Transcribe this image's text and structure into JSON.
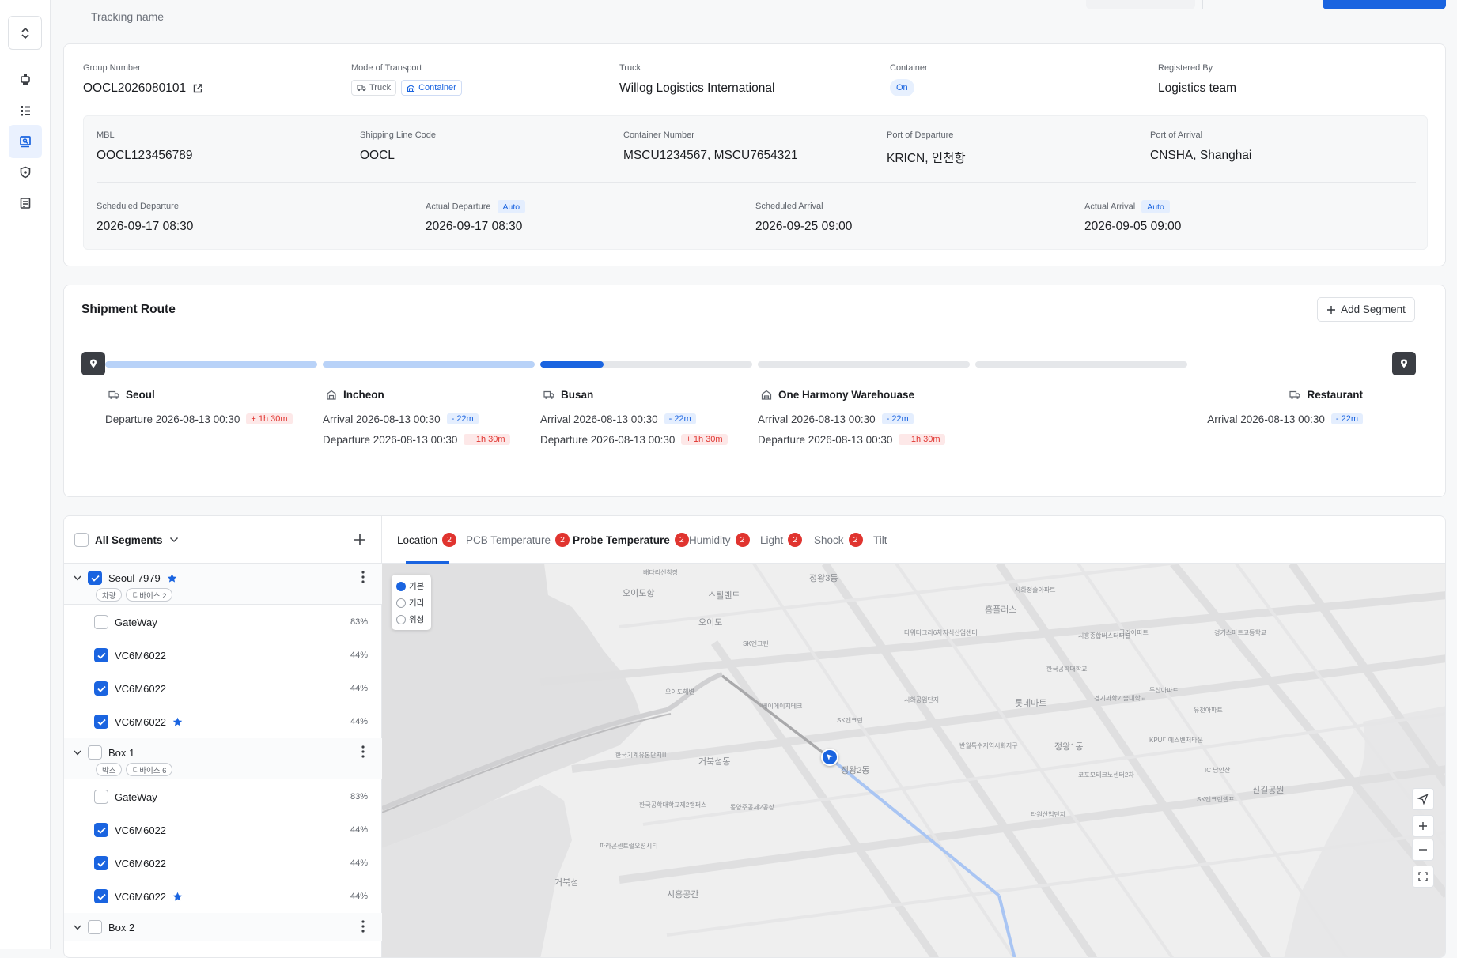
{
  "header": {
    "tracking_label": "Tracking name"
  },
  "info": {
    "group_number": {
      "label": "Group Number",
      "value": "OOCL2026080101"
    },
    "mode": {
      "label": "Mode of Transport",
      "tags": [
        "Truck",
        "Container"
      ]
    },
    "truck": {
      "label": "Truck",
      "value": "Willog Logistics International"
    },
    "container": {
      "label": "Container",
      "value": "On"
    },
    "registered": {
      "label": "Registered By",
      "value": "Logistics team"
    },
    "mbl": {
      "label": "MBL",
      "value": "OOCL123456789"
    },
    "shipping_line": {
      "label": "Shipping Line Code",
      "value": "OOCL"
    },
    "container_number": {
      "label": "Container Number",
      "value": "MSCU1234567, MSCU7654321"
    },
    "pod": {
      "label": "Port of Departure",
      "value": "KRICN, 인천항"
    },
    "poa": {
      "label": "Port of Arrival",
      "value": "CNSHA, Shanghai"
    },
    "sched_dep": {
      "label": "Scheduled Departure",
      "value": "2026-09-17 08:30"
    },
    "actual_dep": {
      "label": "Actual Departure",
      "auto": "Auto",
      "value": "2026-09-17 08:30"
    },
    "sched_arr": {
      "label": "Scheduled Arrival",
      "value": "2026-09-25 09:00"
    },
    "actual_arr": {
      "label": "Actual Arrival",
      "auto": "Auto",
      "value": "2026-09-05 09:00"
    }
  },
  "route": {
    "title": "Shipment Route",
    "add_segment": "Add Segment",
    "progress": [
      1,
      1,
      0.3,
      0,
      0
    ],
    "stops": [
      {
        "name": "Seoul",
        "icon": "truck-icon",
        "lines": [
          {
            "text": "Departure 2026-08-13 00:30",
            "delta": "+ 1h 30m",
            "type": "late"
          }
        ]
      },
      {
        "name": "Incheon",
        "icon": "container-icon",
        "lines": [
          {
            "text": "Arrival 2026-08-13 00:30",
            "delta": "- 22m",
            "type": "early"
          },
          {
            "text": "Departure 2026-08-13 00:30",
            "delta": "+ 1h 30m",
            "type": "late"
          }
        ]
      },
      {
        "name": "Busan",
        "icon": "truck-icon",
        "lines": [
          {
            "text": "Arrival 2026-08-13 00:30",
            "delta": "- 22m",
            "type": "early"
          },
          {
            "text": "Departure 2026-08-13 00:30",
            "delta": "+ 1h 30m",
            "type": "late"
          }
        ]
      },
      {
        "name": "One Harmony Warehouase",
        "icon": "warehouse-icon",
        "lines": [
          {
            "text": "Arrival 2026-08-13 00:30",
            "delta": "- 22m",
            "type": "early"
          },
          {
            "text": "Departure 2026-08-13 00:30",
            "delta": "+ 1h 30m",
            "type": "late"
          }
        ]
      },
      {
        "name": "Restaurant",
        "icon": "truck-icon",
        "lines": [
          {
            "text": "Arrival 2026-08-13 00:30",
            "delta": "- 22m",
            "type": "early"
          }
        ]
      }
    ]
  },
  "segments": {
    "all_label": "All Segments",
    "groups": [
      {
        "name": "Seoul 7979",
        "checked": true,
        "starred": true,
        "chips": [
          "차량",
          "디바이스 2"
        ],
        "devices": [
          {
            "name": "GateWay",
            "checked": false,
            "starred": false,
            "pct": "83%"
          },
          {
            "name": "VC6M6022",
            "checked": true,
            "starred": false,
            "pct": "44%"
          },
          {
            "name": "VC6M6022",
            "checked": true,
            "starred": false,
            "pct": "44%"
          },
          {
            "name": "VC6M6022",
            "checked": true,
            "starred": true,
            "pct": "44%"
          }
        ]
      },
      {
        "name": "Box 1",
        "checked": false,
        "starred": false,
        "chips": [
          "박스",
          "디바이스 6"
        ],
        "devices": [
          {
            "name": "GateWay",
            "checked": false,
            "starred": false,
            "pct": "83%"
          },
          {
            "name": "VC6M6022",
            "checked": true,
            "starred": false,
            "pct": "44%"
          },
          {
            "name": "VC6M6022",
            "checked": true,
            "starred": false,
            "pct": "44%"
          },
          {
            "name": "VC6M6022",
            "checked": true,
            "starred": true,
            "pct": "44%"
          }
        ]
      },
      {
        "name": "Box 2",
        "checked": false,
        "starred": false,
        "chips": [],
        "devices": []
      }
    ]
  },
  "tabs": [
    {
      "label": "Location",
      "count": "2"
    },
    {
      "label": "PCB Temperature",
      "count": "2"
    },
    {
      "label": "Probe Temperature",
      "count": "2"
    },
    {
      "label": "Humidity",
      "count": "2"
    },
    {
      "label": "Light",
      "count": "2"
    },
    {
      "label": "Shock",
      "count": "2"
    },
    {
      "label": "Tilt",
      "count": ""
    }
  ],
  "map": {
    "options": [
      "기본",
      "거리",
      "위성"
    ],
    "selected_option": "기본",
    "labels": [
      "배다리선착장",
      "오이도항",
      "스틸랜드",
      "정왕3동",
      "오이도",
      "SK엔크린",
      "시화정솔아파트",
      "홈플러스",
      "타워타크라6차지식산업센터",
      "시흥종합버스터미널",
      "금강아파트",
      "경기스마트고등학교",
      "한국공학대학교",
      "오이도해변",
      "베이에이지테크",
      "SK엔크린",
      "시화공업단지",
      "롯데마트",
      "경기과학기술대학교",
      "두산아파트",
      "유천아파트",
      "한국기계유통단지Ⅲ",
      "거북섬동",
      "반월특수지역시화지구",
      "정왕1동",
      "KPU디에스벤처타운",
      "코포모테크노센터2차",
      "IC 남안산",
      "신길공원",
      "한국공학대학교제2캠퍼스",
      "동양주공제2공장",
      "SK엔크린셀프",
      "타원산업단지",
      "파라곤센트럴오션시티",
      "거북섬",
      "시흥공간",
      "정왕2동"
    ]
  },
  "colors": {
    "primary": "#1a64e0",
    "late": "#e0342f",
    "early": "#1a64e0",
    "bar_done": "#b8d2f8",
    "bar_todo": "#e5e7ea"
  }
}
